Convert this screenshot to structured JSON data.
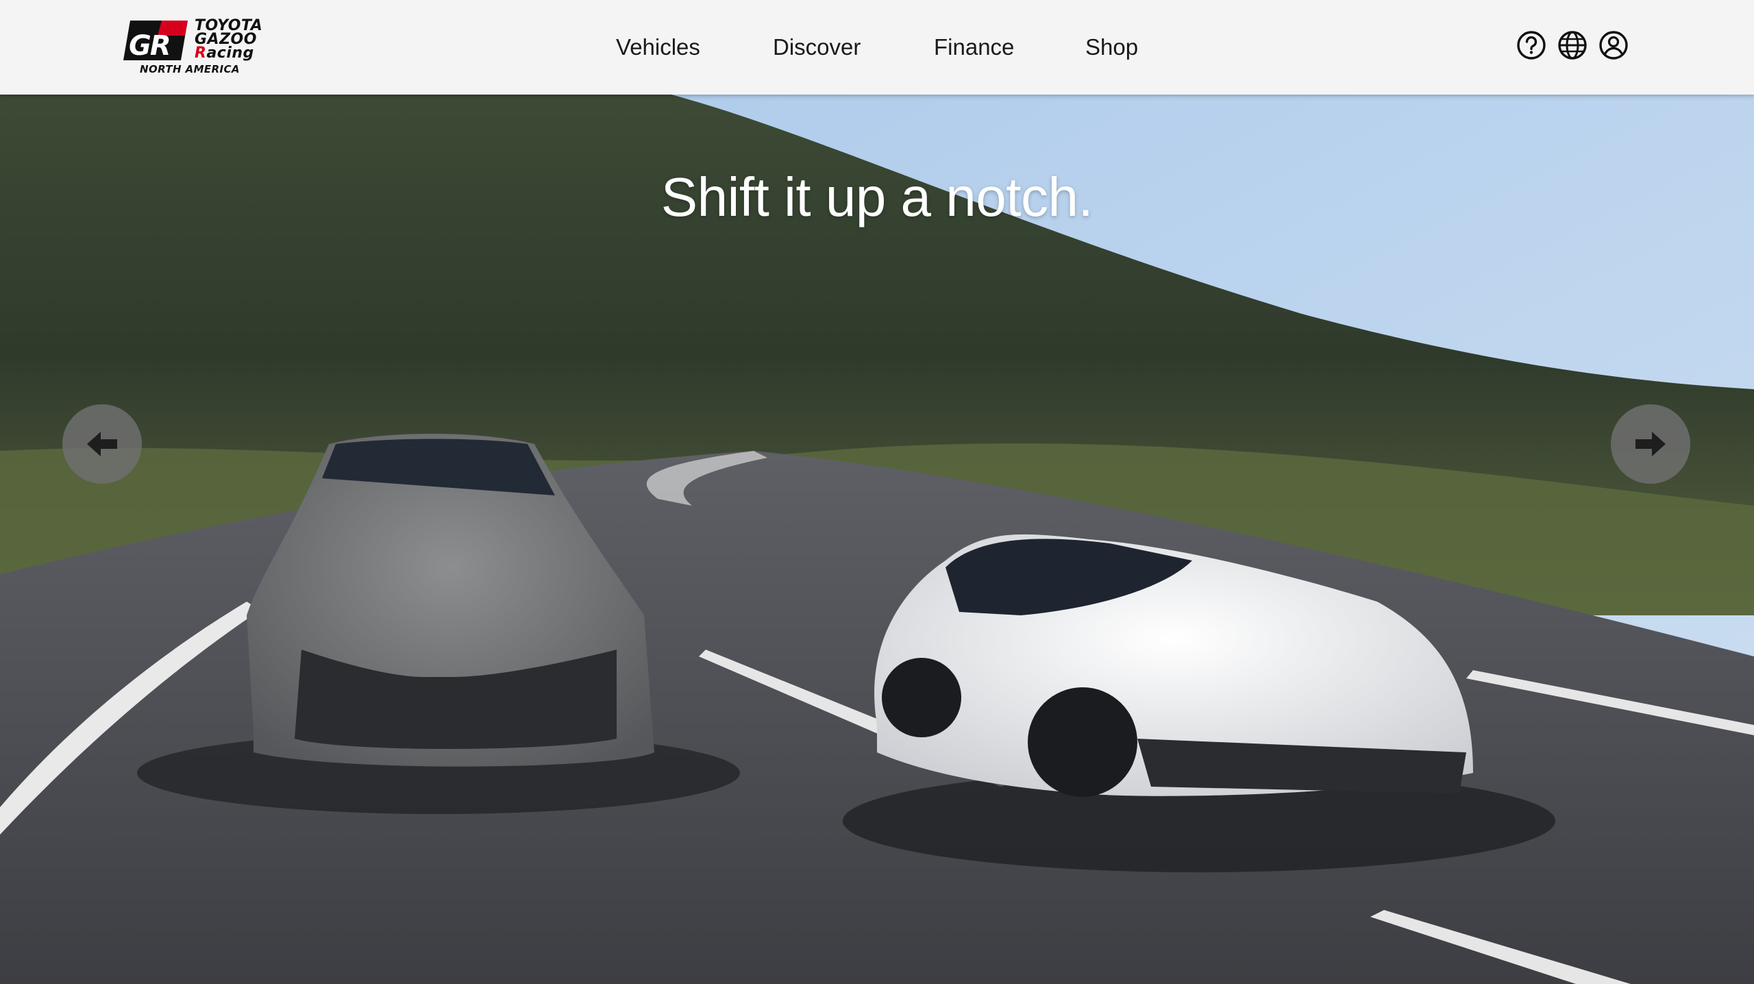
{
  "header": {
    "logo": {
      "mark": "GR",
      "words": [
        "TOYOTA",
        "GAZOO",
        "Racing"
      ],
      "sub": "NORTH AMERICA"
    },
    "nav": [
      "Vehicles",
      "Discover",
      "Finance",
      "Shop"
    ],
    "icons": [
      "help-icon",
      "globe-icon",
      "account-icon"
    ]
  },
  "hero": {
    "headline": "Shift it up a notch.",
    "prev_icon": "arrow-left-icon",
    "next_icon": "arrow-right-icon"
  },
  "colors": {
    "header_bg": "#f4f4f4",
    "brand_red": "#d6001c",
    "arrow_bg": "#6e6e6e",
    "headline_text": "#ffffff"
  }
}
